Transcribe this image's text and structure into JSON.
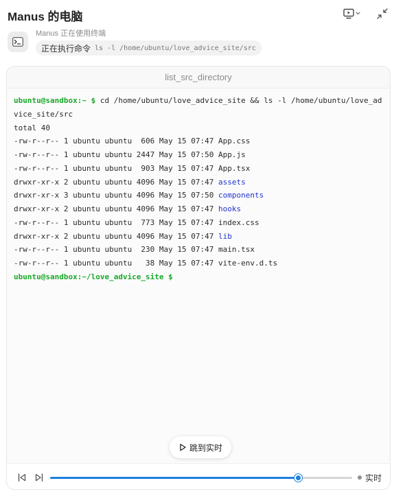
{
  "header": {
    "title": "Manus 的电脑"
  },
  "activity": {
    "status": "Manus 正在使用终端",
    "action_label": "正在执行命令",
    "command": "ls -l /home/ubuntu/love_advice_site/src"
  },
  "terminal": {
    "title": "list_src_directory",
    "prompt_home": "ubuntu@sandbox:~ $",
    "command_line_1": " cd /home/ubuntu/love_advice_site && ls -l /home/ubuntu/love_ad",
    "command_line_2": "vice_site/src",
    "total": "total 40",
    "entries": [
      {
        "meta": "-rw-r--r-- 1 ubuntu ubuntu  606 May 15 07:47 ",
        "name": "App.css",
        "is_dir": false
      },
      {
        "meta": "-rw-r--r-- 1 ubuntu ubuntu 2447 May 15 07:50 ",
        "name": "App.js",
        "is_dir": false
      },
      {
        "meta": "-rw-r--r-- 1 ubuntu ubuntu  903 May 15 07:47 ",
        "name": "App.tsx",
        "is_dir": false
      },
      {
        "meta": "drwxr-xr-x 2 ubuntu ubuntu 4096 May 15 07:47 ",
        "name": "assets",
        "is_dir": true
      },
      {
        "meta": "drwxr-xr-x 3 ubuntu ubuntu 4096 May 15 07:50 ",
        "name": "components",
        "is_dir": true
      },
      {
        "meta": "drwxr-xr-x 2 ubuntu ubuntu 4096 May 15 07:47 ",
        "name": "hooks",
        "is_dir": true
      },
      {
        "meta": "-rw-r--r-- 1 ubuntu ubuntu  773 May 15 07:47 ",
        "name": "index.css",
        "is_dir": false
      },
      {
        "meta": "drwxr-xr-x 2 ubuntu ubuntu 4096 May 15 07:47 ",
        "name": "lib",
        "is_dir": true
      },
      {
        "meta": "-rw-r--r-- 1 ubuntu ubuntu  230 May 15 07:47 ",
        "name": "main.tsx",
        "is_dir": false
      },
      {
        "meta": "-rw-r--r-- 1 ubuntu ubuntu   38 May 15 07:47 ",
        "name": "vite-env.d.ts",
        "is_dir": false
      }
    ],
    "final_prompt": "ubuntu@sandbox:~/love_advice_site $"
  },
  "playback": {
    "jump_live_label": "跳到实时",
    "progress_fraction": 0.82,
    "live_label": "实时"
  },
  "colors": {
    "prompt": "#1aa82a",
    "directory": "#2233cc",
    "progress": "#1a7fe0"
  },
  "icons": {
    "screen": "monitor-play-icon",
    "collapse": "collapse-arrows-icon",
    "terminal": "terminal-icon",
    "play": "play-icon",
    "prev": "skip-back-icon",
    "next": "skip-forward-icon"
  }
}
